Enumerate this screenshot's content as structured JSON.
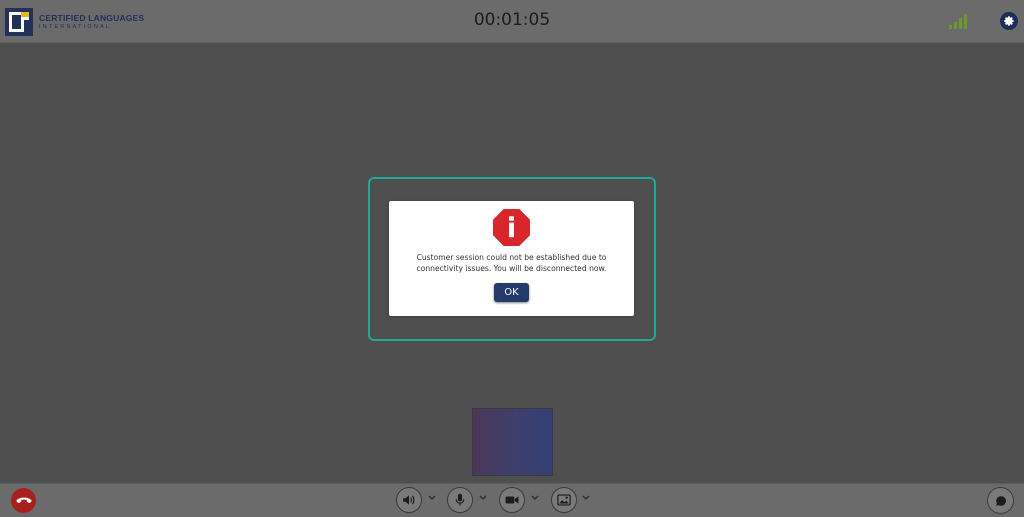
{
  "header": {
    "logo_line1": "CERTIFIED LANGUAGES",
    "logo_line2": "INTERNATIONAL",
    "timer": "00:01:05",
    "icons": {
      "signal": "signal-strength-icon",
      "settings": "gear-icon"
    }
  },
  "dialog": {
    "icon": "alert-octagon-icon",
    "message": "Customer session could not be established due to connectivity issues. You will be disconnected now.",
    "ok_label": "OK"
  },
  "controls": {
    "hangup": "phone-hangup-icon",
    "speaker": "speaker-icon",
    "microphone": "microphone-icon",
    "camera": "video-camera-icon",
    "background": "image-icon",
    "chat": "chat-icon"
  },
  "colors": {
    "accent": "#1fa797",
    "primary": "#233a6a",
    "danger": "#d9262c",
    "hangup": "#a8201d",
    "signal": "#6b9c2a"
  }
}
